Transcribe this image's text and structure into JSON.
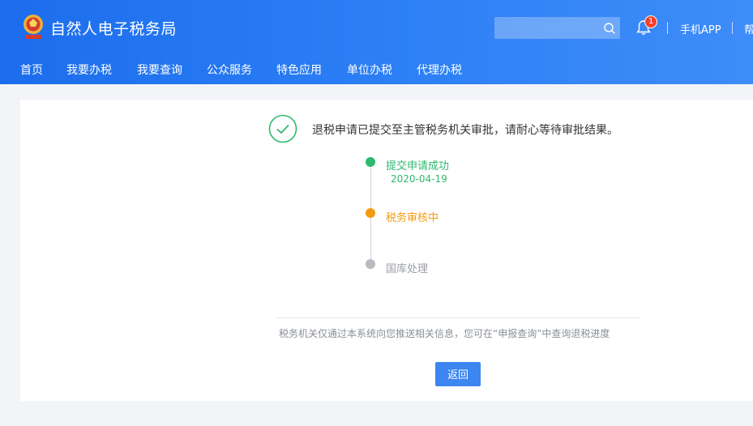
{
  "header": {
    "site_title": "自然人电子税务局",
    "search": {
      "placeholder": "",
      "value": ""
    },
    "notification_count": "1",
    "links": [
      "手机APP",
      "帮"
    ],
    "colors": {
      "header_start": "#1c6ded",
      "header_end": "#3e8cf8"
    }
  },
  "nav": {
    "items": [
      "首页",
      "我要办税",
      "我要查询",
      "公众服务",
      "特色应用",
      "单位办税",
      "代理办税"
    ]
  },
  "result": {
    "message": "退税申请已提交至主管税务机关审批，请耐心等待审批结果。",
    "steps": [
      {
        "title": "提交申请成功",
        "date": "2020-04-19",
        "status": "done",
        "color": "#2fb96f"
      },
      {
        "title": "税务审核中",
        "status": "current",
        "color": "#f29b11"
      },
      {
        "title": "国库处理",
        "status": "pending",
        "color": "#b8bbc0"
      }
    ],
    "notice": "税务机关仅通过本系统向您推送相关信息，您可在“申报查询”中查询退税进度",
    "back_label": "返回"
  },
  "icons": [
    "tax-emblem-logo-icon",
    "search-icon",
    "bell-icon",
    "check-circle-icon"
  ]
}
